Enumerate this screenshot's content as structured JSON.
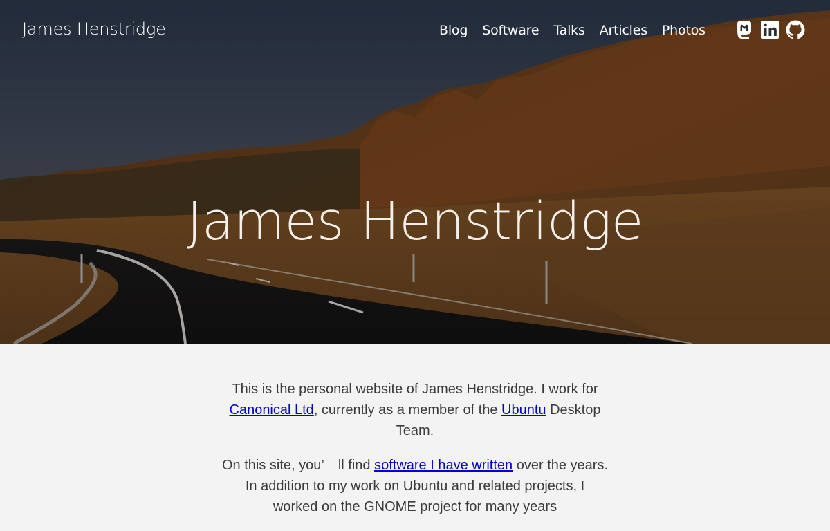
{
  "header": {
    "site_title": "James Henstridge",
    "nav": [
      {
        "label": "Blog"
      },
      {
        "label": "Software"
      },
      {
        "label": "Talks"
      },
      {
        "label": "Articles"
      },
      {
        "label": "Photos"
      }
    ],
    "social_icons": [
      "mastodon-icon",
      "linkedin-icon",
      "github-icon"
    ]
  },
  "hero": {
    "title": "James Henstridge"
  },
  "intro": {
    "p1_part1": "This is the personal website of James Henstridge. I work for ",
    "p1_link1": "Canonical Ltd",
    "p1_part2": ", currently as a member of the ",
    "p1_link2": "Ubuntu",
    "p1_part3": " Desktop Team.",
    "p2_part1": "On this site, you’ ll find ",
    "p2_link1": "software I have written",
    "p2_part2": " over the years. In addition to my work on Ubuntu and related projects, I worked on the GNOME project for many years"
  },
  "colors": {
    "page_bg": "#f3f3f3",
    "link": "#0000cc",
    "body_text": "#3b3b3b"
  }
}
